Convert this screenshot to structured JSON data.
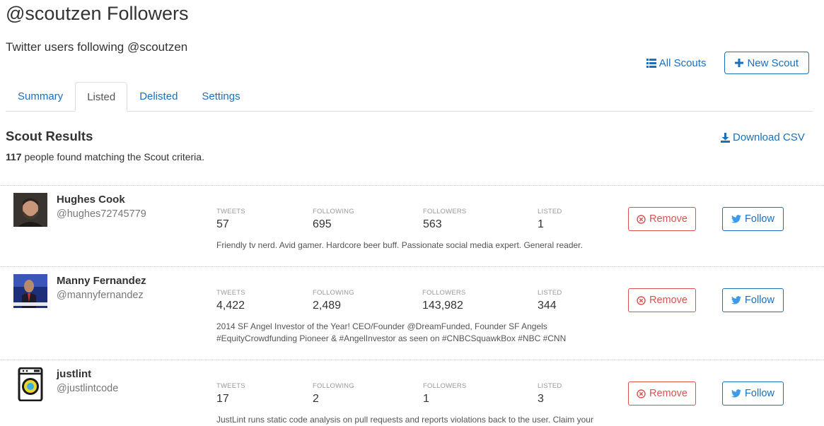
{
  "header": {
    "title": "@scoutzen Followers",
    "subtitle": "Twitter users following @scoutzen",
    "all_scouts_label": "All Scouts",
    "new_scout_label": "New Scout"
  },
  "tabs": [
    {
      "label": "Summary"
    },
    {
      "label": "Listed"
    },
    {
      "label": "Delisted"
    },
    {
      "label": "Settings"
    }
  ],
  "active_tab": "Listed",
  "results": {
    "title": "Scout Results",
    "count": "117",
    "count_suffix": "people found matching the Scout criteria.",
    "download_label": "Download CSV"
  },
  "stat_labels": {
    "tweets": "TWEETS",
    "following": "FOLLOWING",
    "followers": "FOLLOWERS",
    "listed": "LISTED"
  },
  "actions": {
    "remove_label": "Remove",
    "follow_label": "Follow"
  },
  "users": [
    {
      "name": "Hughes Cook",
      "handle": "@hughes72745779",
      "tweets": "57",
      "following": "695",
      "followers": "563",
      "listed": "1",
      "bio": "Friendly tv nerd. Avid gamer. Hardcore beer buff. Passionate social media expert. General reader."
    },
    {
      "name": "Manny Fernandez",
      "handle": "@mannyfernandez",
      "tweets": "4,422",
      "following": "2,489",
      "followers": "143,982",
      "listed": "344",
      "bio": "2014 SF Angel Investor of the Year! CEO/Founder @DreamFunded, Founder SF Angels #EquityCrowdfunding Pioneer & #AngelInvestor as seen on #CNBCSquawkBox #NBC #CNN"
    },
    {
      "name": "justlint",
      "handle": "@justlintcode",
      "tweets": "17",
      "following": "2",
      "followers": "1",
      "listed": "3",
      "bio": "JustLint runs static code analysis on pull requests and reports violations back to the user. Claim your"
    }
  ]
}
